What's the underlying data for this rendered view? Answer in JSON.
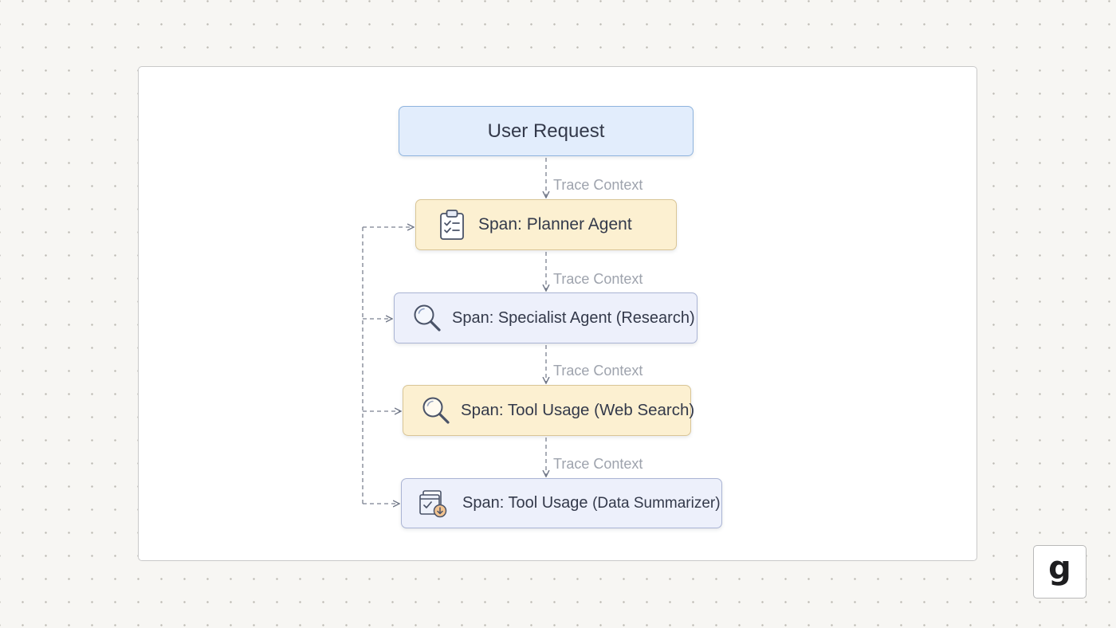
{
  "diagram": {
    "nodes": [
      {
        "id": "user_request",
        "label": "User Request",
        "icon": ""
      },
      {
        "id": "planner_agent",
        "label": "Span: Planner Agent",
        "icon": "clipboard-checklist-icon"
      },
      {
        "id": "specialist_agent",
        "label": "Span: Specialist Agent (Research)",
        "icon": "magnifying-glass-icon"
      },
      {
        "id": "web_search",
        "label": "Span: Tool Usage (Web Search)",
        "icon": "magnifying-glass-icon"
      },
      {
        "id": "data_summarizer",
        "label_main": "Span: Tool Usage",
        "label_sub": "(Data Summarizer)",
        "icon": "document-download-icon"
      }
    ],
    "edges": [
      {
        "from": "user_request",
        "to": "planner_agent",
        "label": "Trace Context"
      },
      {
        "from": "planner_agent",
        "to": "specialist_agent",
        "label": "Trace Context"
      },
      {
        "from": "specialist_agent",
        "to": "web_search",
        "label": "Trace Context"
      },
      {
        "from": "web_search",
        "to": "data_summarizer",
        "label": "Trace Context"
      }
    ],
    "side_bus_targets": [
      "planner_agent",
      "specialist_agent",
      "web_search",
      "data_summarizer"
    ],
    "colors": {
      "blue_fill": "#e2edfc",
      "yellow_fill": "#fcf0d1",
      "lavender_fill": "#edf0fb",
      "connector": "#6f7686"
    }
  },
  "branding": {
    "logo_letter": "g"
  }
}
